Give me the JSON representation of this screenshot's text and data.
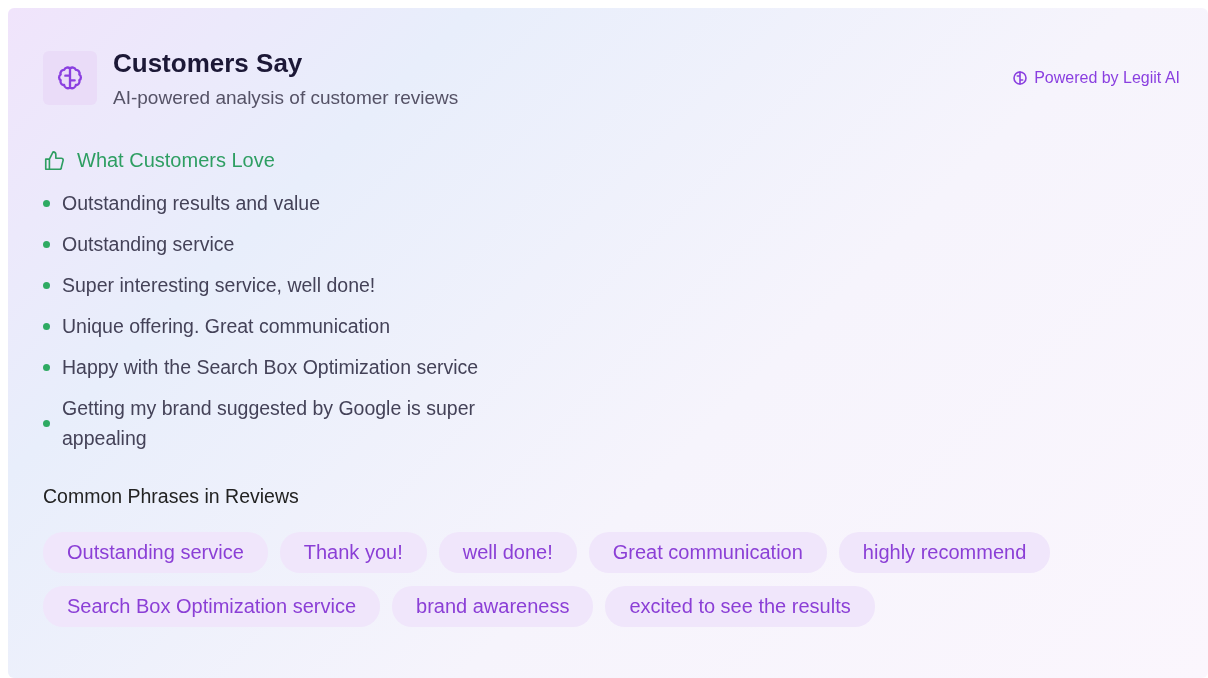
{
  "header": {
    "title": "Customers Say",
    "subtitle": "AI-powered analysis of customer reviews",
    "powered_by": "Powered by Legiit AI"
  },
  "love": {
    "heading": "What Customers Love",
    "items": [
      "Outstanding results and value",
      "Outstanding service",
      "Super interesting service, well done!",
      "Unique offering. Great communication",
      "Happy with the Search Box Optimization service",
      "Getting my brand suggested by Google is super appealing"
    ]
  },
  "phrases": {
    "heading": "Common Phrases in Reviews",
    "tags": [
      "Outstanding service",
      "Thank you!",
      "well done!",
      "Great communication",
      "highly recommend",
      "Search Box Optimization service",
      "brand awareness",
      "excited to see the results"
    ]
  }
}
